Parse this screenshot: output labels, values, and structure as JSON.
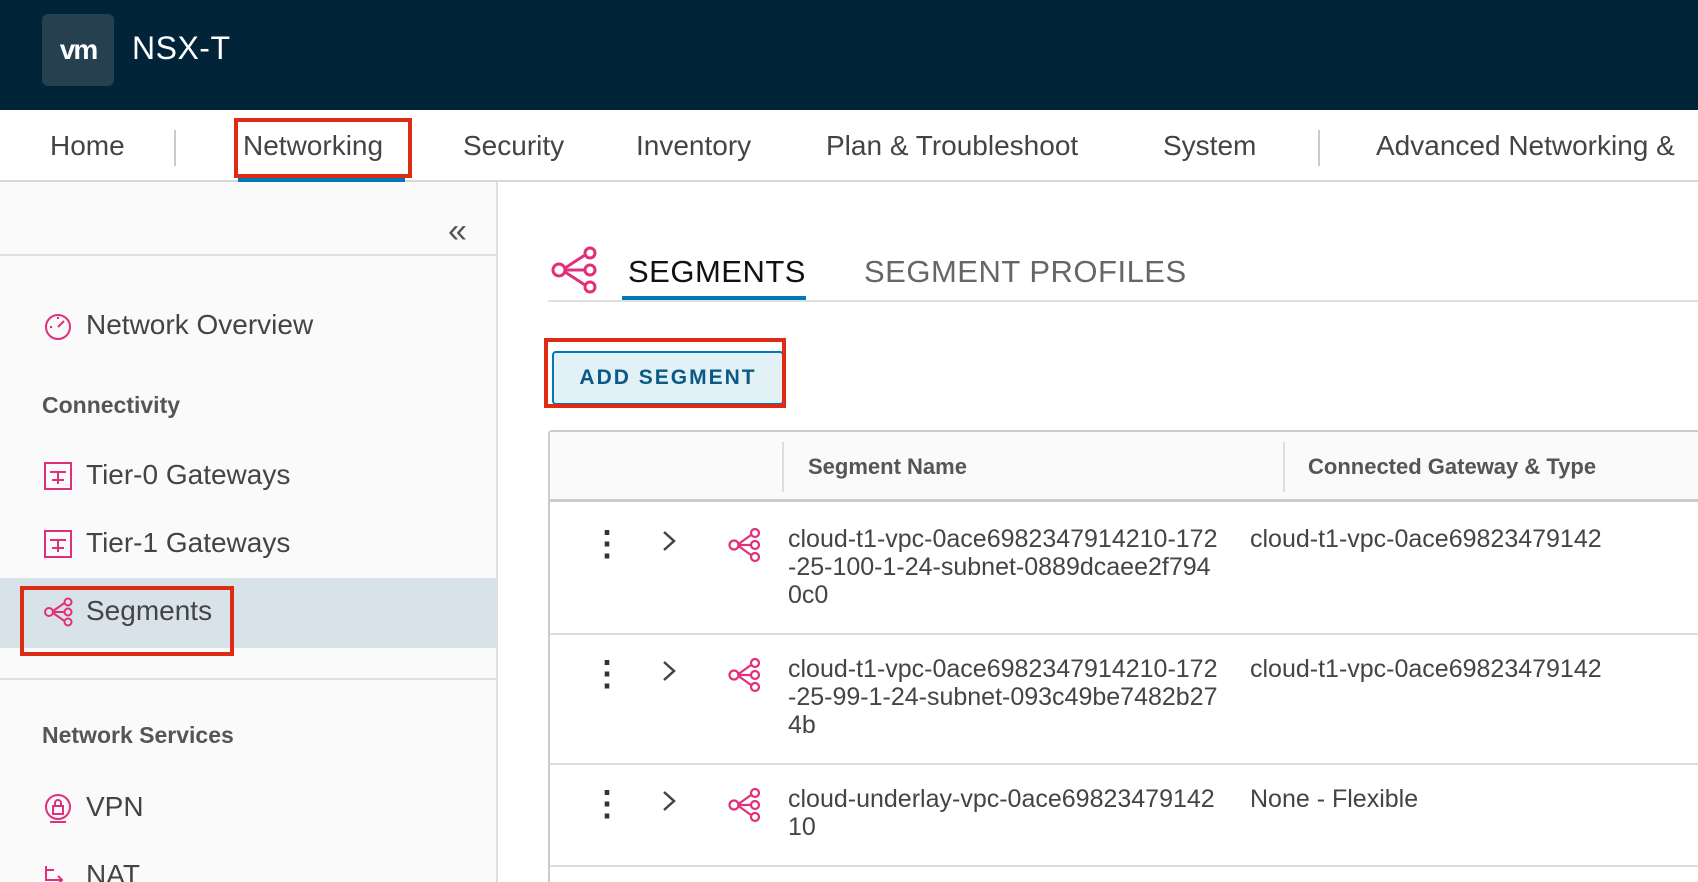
{
  "header": {
    "logo": "vm",
    "app_title": "NSX-T"
  },
  "topnav": {
    "items": [
      "Home",
      "Networking",
      "Security",
      "Inventory",
      "Plan & Troubleshoot",
      "System",
      "Advanced Networking &"
    ]
  },
  "sidebar": {
    "collapse_glyph": "«",
    "overview": "Network Overview",
    "connectivity_title": "Connectivity",
    "connectivity_items": [
      "Tier-0 Gateways",
      "Tier-1 Gateways",
      "Segments"
    ],
    "services_title": "Network Services",
    "services_items": [
      "VPN",
      "NAT"
    ]
  },
  "main": {
    "tabs": [
      "SEGMENTS",
      "SEGMENT PROFILES"
    ],
    "add_button": "ADD SEGMENT",
    "columns": [
      "Segment Name",
      "Connected Gateway & Type"
    ],
    "rows": [
      {
        "name": "cloud-t1-vpc-0ace6982347914210-172-25-100-1-24-subnet-0889dcaee2f7940c0",
        "gateway": "cloud-t1-vpc-0ace69823479142"
      },
      {
        "name": "cloud-t1-vpc-0ace6982347914210-172-25-99-1-24-subnet-093c49be7482b274b",
        "gateway": "cloud-t1-vpc-0ace69823479142"
      },
      {
        "name": "cloud-underlay-vpc-0ace6982347914210",
        "gateway": "None - Flexible"
      }
    ]
  },
  "colors": {
    "accent": "#0079b8",
    "highlight": "#de2b14",
    "icon_pink": "#e0307a",
    "header_bg": "#012438"
  }
}
